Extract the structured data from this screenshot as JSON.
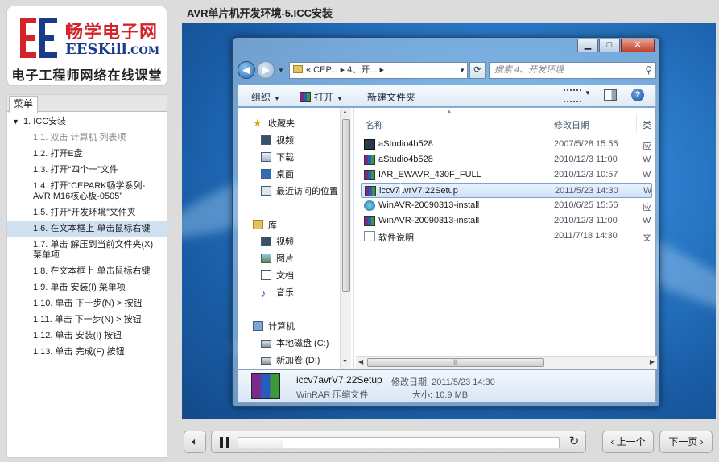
{
  "brand": {
    "name_cn": "畅学电子网",
    "name_en": "EESKill",
    "name_en_suffix": ".COM",
    "tagline": "电子工程师网络在线课堂",
    "colors": {
      "red": "#d4232b",
      "blue": "#1a3a8a"
    }
  },
  "menu": {
    "tab_label": "菜单",
    "section": "1. ICC安装",
    "items": [
      {
        "label": "1.1. 双击 计算机 列表项",
        "state": "done"
      },
      {
        "label": "1.2. 打开E盘",
        "state": "normal"
      },
      {
        "label": "1.3. 打开“四个一”文件",
        "state": "normal"
      },
      {
        "label": "1.4. 打开“CEPARK畅学系列-AVR M16核心板-0505”",
        "state": "normal"
      },
      {
        "label": "1.5. 打开“开发环境”文件夹",
        "state": "normal"
      },
      {
        "label": "1.6. 在文本框上 单击鼠标右键",
        "state": "active"
      },
      {
        "label": "1.7. 单击 解压到当前文件夹(X) 菜单项",
        "state": "normal"
      },
      {
        "label": "1.8. 在文本框上 单击鼠标右键",
        "state": "normal"
      },
      {
        "label": "1.9. 单击 安装(I) 菜单项",
        "state": "normal"
      },
      {
        "label": "1.10. 单击 下一步(N) > 按钮",
        "state": "normal"
      },
      {
        "label": "1.11. 单击 下一步(N) > 按钮",
        "state": "normal"
      },
      {
        "label": "1.12. 单击 安装(I) 按钮",
        "state": "normal"
      },
      {
        "label": "1.13. 单击 完成(F) 按钮",
        "state": "normal"
      }
    ]
  },
  "lesson_title": "AVR单片机开发环境-5.ICC安装",
  "explorer": {
    "window_buttons": {
      "minimize": "▁",
      "maximize": "□",
      "close": "✕"
    },
    "address": "« CEP... ▸ 4、开... ▸",
    "search_placeholder": "搜索 4、开发环境",
    "toolbar": {
      "organize": "组织",
      "open": "打开",
      "new_folder": "新建文件夹"
    },
    "nav": {
      "favorites_header": "收藏夹",
      "favorites": [
        "视频",
        "下载",
        "桌面",
        "最近访问的位置"
      ],
      "libraries_header": "库",
      "libraries": [
        "视频",
        "图片",
        "文档",
        "音乐"
      ],
      "computer_header": "计算机",
      "drives": [
        "本地磁盘 (C:)",
        "新加卷 (D:)"
      ]
    },
    "columns": {
      "name": "名称",
      "date": "修改日期",
      "type": "类"
    },
    "files": [
      {
        "name": "aStudio4b528",
        "date": "2007/5/28 15:55",
        "type": "应",
        "icon": "app-icon",
        "selected": false
      },
      {
        "name": "aStudio4b528",
        "date": "2010/12/3 11:00",
        "type": "W",
        "icon": "winrar-icon",
        "selected": false
      },
      {
        "name": "IAR_EWAVR_430F_FULL",
        "date": "2010/12/3 10:57",
        "type": "W",
        "icon": "winrar-icon",
        "selected": false
      },
      {
        "name": "iccv7avrV7.22Setup",
        "date": "2011/5/23 14:30",
        "type": "W",
        "icon": "winrar-icon",
        "selected": true
      },
      {
        "name": "WinAVR-20090313-install",
        "date": "2010/6/25 15:56",
        "type": "应",
        "icon": "winavr-icon",
        "selected": false
      },
      {
        "name": "WinAVR-20090313-install",
        "date": "2010/12/3 11:00",
        "type": "W",
        "icon": "winrar-icon",
        "selected": false
      },
      {
        "name": "软件说明",
        "date": "2011/7/18 14:30",
        "type": "文",
        "icon": "text-file-icon",
        "selected": false
      }
    ],
    "details": {
      "name": "iccv7avrV7.22Setup",
      "modified": "修改日期: 2011/5/23 14:30",
      "type": "WinRAR 压缩文件",
      "size": "大小: 10.9 MB"
    }
  },
  "player": {
    "progress": 0.14,
    "prev_label": "‹ 上一个",
    "next_label": "下一页 ›"
  }
}
